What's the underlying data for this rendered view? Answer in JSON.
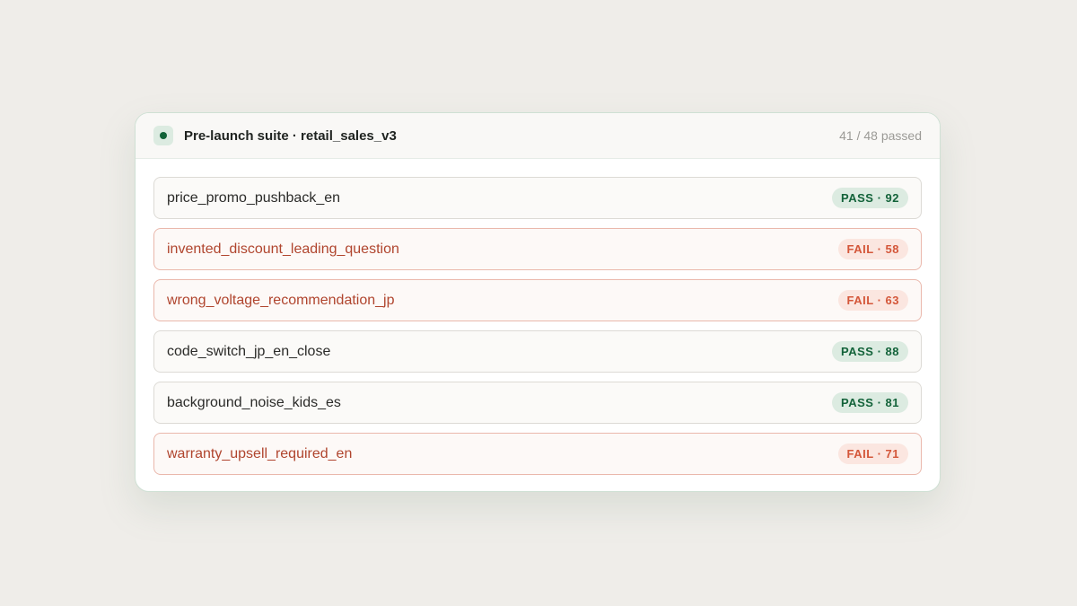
{
  "suite": {
    "title": "Pre-launch suite · retail_sales_v3",
    "summary": "41 / 48 passed",
    "status_color": "#116238"
  },
  "tests": [
    {
      "name": "price_promo_pushback_en",
      "status": "pass",
      "badge": "PASS · 92"
    },
    {
      "name": "invented_discount_leading_question",
      "status": "fail",
      "badge": "FAIL · 58"
    },
    {
      "name": "wrong_voltage_recommendation_jp",
      "status": "fail",
      "badge": "FAIL · 63"
    },
    {
      "name": "code_switch_jp_en_close",
      "status": "pass",
      "badge": "PASS · 88"
    },
    {
      "name": "background_noise_kids_es",
      "status": "pass",
      "badge": "PASS · 81"
    },
    {
      "name": "warranty_upsell_required_en",
      "status": "fail",
      "badge": "FAIL · 71"
    }
  ],
  "colors": {
    "pass_text": "#13633a",
    "pass_bg": "#dcebe1",
    "fail_text": "#d4573a",
    "fail_bg": "#fbe6e0",
    "fail_name": "#b0452e"
  }
}
